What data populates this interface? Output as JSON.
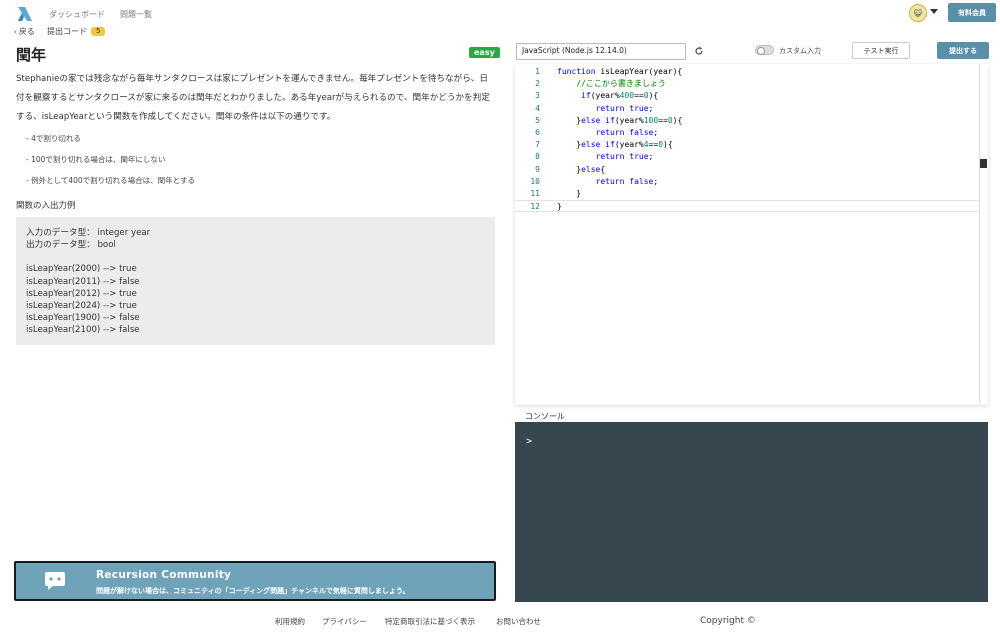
{
  "nav": {
    "dashboard": "ダッシュボード",
    "problems": "問題一覧",
    "member_button": "有料会員",
    "avatar_text": "😺"
  },
  "subbar": {
    "back": "戻る",
    "submit_code": "提出コード",
    "submit_count": "5"
  },
  "problem": {
    "title": "閏年",
    "difficulty": "easy",
    "description": "Stephanieの家では残念ながら毎年サンタクロースは家にプレゼントを運んできません。毎年プレゼントを待ちながら、日付を観察するとサンタクロースが家に来るのは閏年だとわかりました。ある年yearが与えられるので、閏年かどうかを判定する、isLeapYearという関数を作成してください。閏年の条件は以下の通りです。",
    "conditions": [
      "- 4で割り切れる",
      "- 100で割り切れる場合は、閏年にしない",
      "- 例外として400で割り切れる場合は、閏年とする"
    ],
    "io_heading": "関数の入出力例",
    "io_types": [
      "入力のデータ型： integer year",
      "出力のデータ型： bool"
    ],
    "examples": [
      "isLeapYear(2000) --> true",
      "isLeapYear(2011) --> false",
      "isLeapYear(2012) --> true",
      "isLeapYear(2024) --> true",
      "isLeapYear(1900) --> false",
      "isLeapYear(2100) --> false"
    ]
  },
  "community": {
    "title": "Recursion Community",
    "subtitle": "問題が解けない場合は、コミュニティの「コーディング問題」チャンネルで気軽に質問しましょう。"
  },
  "toolbar": {
    "language": "JavaScript (Node.js 12.14.0)",
    "custom_input": "カスタム入力",
    "test_run": "テスト実行",
    "submit": "提出する"
  },
  "editor": {
    "lines": [
      {
        "n": "1",
        "t": "function isLeapYear(year){"
      },
      {
        "n": "2",
        "t": "    //ここから書きましょう"
      },
      {
        "n": "3",
        "t": "     if(year%400==0){"
      },
      {
        "n": "4",
        "t": "        return true;"
      },
      {
        "n": "5",
        "t": "    }else if(year%100==0){"
      },
      {
        "n": "6",
        "t": "        return false;"
      },
      {
        "n": "7",
        "t": "    }else if(year%4==0){"
      },
      {
        "n": "8",
        "t": "        return true;"
      },
      {
        "n": "9",
        "t": "    }else{"
      },
      {
        "n": "10",
        "t": "        return false;"
      },
      {
        "n": "11",
        "t": "    }"
      },
      {
        "n": "12",
        "t": "}"
      }
    ]
  },
  "console": {
    "label": "コンソール",
    "prompt": ">"
  },
  "footer": {
    "terms": "利用規約",
    "privacy": "プライバシー",
    "legal": "特定商取引法に基づく表示",
    "contact": "お問い合わせ",
    "copyright": "Copyright ©"
  },
  "colors": {
    "accent": "#5b8fa8",
    "difficulty_easy": "#28a745",
    "console_bg": "#37474f",
    "community_bg": "#6fa3ba"
  }
}
